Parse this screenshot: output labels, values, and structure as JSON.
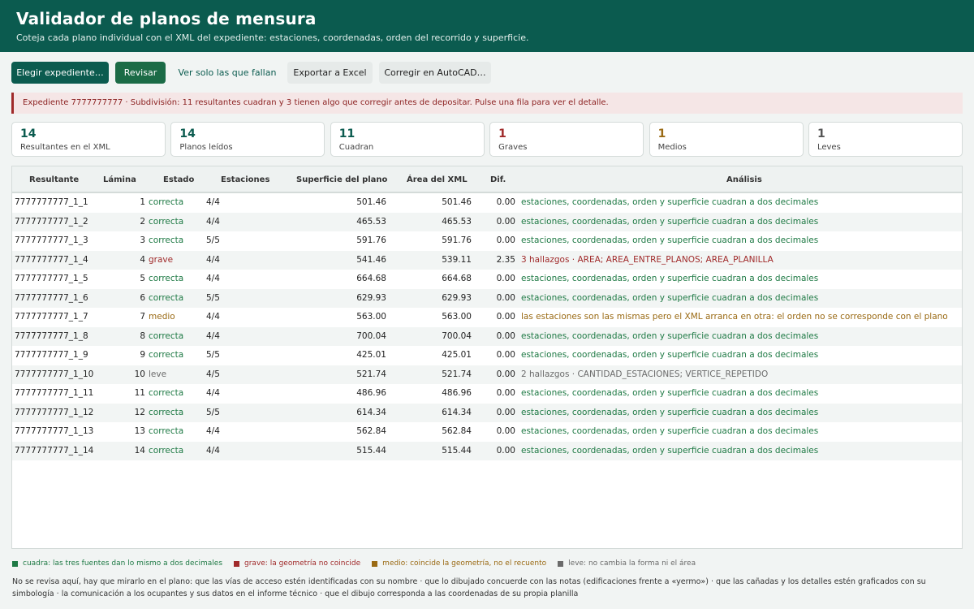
{
  "header": {
    "title": "Validador de planos de mensura",
    "subtitle": "Coteja cada plano individual con el XML del expediente: estaciones, coordenadas, orden del recorrido y superficie."
  },
  "toolbar": {
    "choose": "Elegir expediente…",
    "review": "Revisar",
    "only_failing": "Ver solo las que fallan",
    "export": "Exportar a Excel",
    "fix": "Corregir en AutoCAD…"
  },
  "alert": "Expediente 7777777777 · Subdivisión: 11 resultantes cuadran y 3 tienen algo que corregir antes de depositar. Pulse una fila para ver el detalle.",
  "stats": [
    {
      "value": "14",
      "label": "Resultantes en el XML",
      "color": "#0b5b4f"
    },
    {
      "value": "14",
      "label": "Planos leídos",
      "color": "#0b5b4f"
    },
    {
      "value": "11",
      "label": "Cuadran",
      "color": "#0b5b4f"
    },
    {
      "value": "1",
      "label": "Graves",
      "color": "#a02a2a"
    },
    {
      "value": "1",
      "label": "Medios",
      "color": "#9a6a14"
    },
    {
      "value": "1",
      "label": "Leves",
      "color": "#555555"
    }
  ],
  "table": {
    "headers": [
      "Resultante",
      "Lámina",
      "Estado",
      "Estaciones",
      "Superficie del plano",
      "Área del XML",
      "Dif.",
      "Análisis"
    ],
    "rows": [
      {
        "res": "7777777777_1_1",
        "lam": "1",
        "estado": "correcta",
        "est": "4/4",
        "sup": "501.46",
        "area": "501.46",
        "dif": "0.00",
        "analisis": "estaciones, coordenadas, orden y superficie cuadran a dos decimales",
        "kind": "ok"
      },
      {
        "res": "7777777777_1_2",
        "lam": "2",
        "estado": "correcta",
        "est": "4/4",
        "sup": "465.53",
        "area": "465.53",
        "dif": "0.00",
        "analisis": "estaciones, coordenadas, orden y superficie cuadran a dos decimales",
        "kind": "ok"
      },
      {
        "res": "7777777777_1_3",
        "lam": "3",
        "estado": "correcta",
        "est": "5/5",
        "sup": "591.76",
        "area": "591.76",
        "dif": "0.00",
        "analisis": "estaciones, coordenadas, orden y superficie cuadran a dos decimales",
        "kind": "ok"
      },
      {
        "res": "7777777777_1_4",
        "lam": "4",
        "estado": "grave",
        "est": "4/4",
        "sup": "541.46",
        "area": "539.11",
        "dif": "2.35",
        "analisis": "3 hallazgos · AREA; AREA_ENTRE_PLANOS; AREA_PLANILLA",
        "kind": "grave"
      },
      {
        "res": "7777777777_1_5",
        "lam": "5",
        "estado": "correcta",
        "est": "4/4",
        "sup": "664.68",
        "area": "664.68",
        "dif": "0.00",
        "analisis": "estaciones, coordenadas, orden y superficie cuadran a dos decimales",
        "kind": "ok"
      },
      {
        "res": "7777777777_1_6",
        "lam": "6",
        "estado": "correcta",
        "est": "5/5",
        "sup": "629.93",
        "area": "629.93",
        "dif": "0.00",
        "analisis": "estaciones, coordenadas, orden y superficie cuadran a dos decimales",
        "kind": "ok"
      },
      {
        "res": "7777777777_1_7",
        "lam": "7",
        "estado": "medio",
        "est": "4/4",
        "sup": "563.00",
        "area": "563.00",
        "dif": "0.00",
        "analisis": "las estaciones son las mismas pero el XML arranca en otra: el orden no se corresponde con el plano",
        "kind": "medio"
      },
      {
        "res": "7777777777_1_8",
        "lam": "8",
        "estado": "correcta",
        "est": "4/4",
        "sup": "700.04",
        "area": "700.04",
        "dif": "0.00",
        "analisis": "estaciones, coordenadas, orden y superficie cuadran a dos decimales",
        "kind": "ok"
      },
      {
        "res": "7777777777_1_9",
        "lam": "9",
        "estado": "correcta",
        "est": "5/5",
        "sup": "425.01",
        "area": "425.01",
        "dif": "0.00",
        "analisis": "estaciones, coordenadas, orden y superficie cuadran a dos decimales",
        "kind": "ok"
      },
      {
        "res": "7777777777_1_10",
        "lam": "10",
        "estado": "leve",
        "est": "4/5",
        "sup": "521.74",
        "area": "521.74",
        "dif": "0.00",
        "analisis": "2 hallazgos · CANTIDAD_ESTACIONES; VERTICE_REPETIDO",
        "kind": "leve"
      },
      {
        "res": "7777777777_1_11",
        "lam": "11",
        "estado": "correcta",
        "est": "4/4",
        "sup": "486.96",
        "area": "486.96",
        "dif": "0.00",
        "analisis": "estaciones, coordenadas, orden y superficie cuadran a dos decimales",
        "kind": "ok"
      },
      {
        "res": "7777777777_1_12",
        "lam": "12",
        "estado": "correcta",
        "est": "5/5",
        "sup": "614.34",
        "area": "614.34",
        "dif": "0.00",
        "analisis": "estaciones, coordenadas, orden y superficie cuadran a dos decimales",
        "kind": "ok"
      },
      {
        "res": "7777777777_1_13",
        "lam": "13",
        "estado": "correcta",
        "est": "4/4",
        "sup": "562.84",
        "area": "562.84",
        "dif": "0.00",
        "analisis": "estaciones, coordenadas, orden y superficie cuadran a dos decimales",
        "kind": "ok"
      },
      {
        "res": "7777777777_1_14",
        "lam": "14",
        "estado": "correcta",
        "est": "4/4",
        "sup": "515.44",
        "area": "515.44",
        "dif": "0.00",
        "analisis": "estaciones, coordenadas, orden y superficie cuadran a dos decimales",
        "kind": "ok"
      }
    ]
  },
  "colors": {
    "ok": "#1f7a45",
    "grave": "#a02a2a",
    "medio": "#9a6a14",
    "leve": "#6b6b6b"
  },
  "legend": [
    {
      "label": "cuadra: las tres fuentes dan lo mismo a dos decimales",
      "kind": "ok"
    },
    {
      "label": "grave: la geometría no coincide",
      "kind": "grave"
    },
    {
      "label": "medio: coincide la geometría, no el recuento",
      "kind": "medio"
    },
    {
      "label": "leve: no cambia la forma ni el área",
      "kind": "leve"
    }
  ],
  "note": "No se revisa aquí, hay que mirarlo en el plano: que las vías de acceso estén identificadas con su nombre · que lo dibujado concuerde con las notas (edificaciones frente a «yermo») · que las cañadas y los detalles estén graficados con su simbología · la comunicación a los ocupantes y sus datos en el informe técnico · que el dibujo corresponda a las coordenadas de su propia planilla"
}
